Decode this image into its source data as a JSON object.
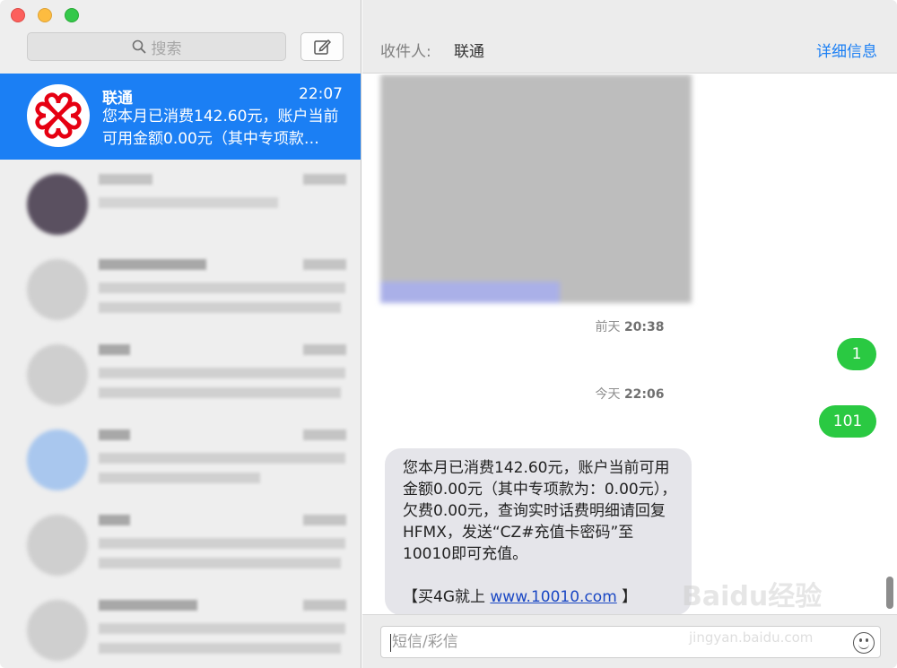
{
  "sidebar": {
    "search_placeholder": "搜索",
    "active_conversation": {
      "name": "联通",
      "time": "22:07",
      "preview": "您本月已消费142.60元，账户当前可用金额0.00元（其中专项款…"
    }
  },
  "header": {
    "recipient_label": "收件人:",
    "recipient_name": "联通",
    "details": "详细信息"
  },
  "chat": {
    "timestamp1_day": "前天",
    "timestamp1_time": "20:38",
    "outgoing1": "1",
    "timestamp2_day": "今天",
    "timestamp2_time": "22:06",
    "outgoing2": "101",
    "incoming_text": "您本月已消费142.60元，账户当前可用金额0.00元（其中专项款为：0.00元），欠费0.00元，查询实时话费明细请回复HFMX，发送“CZ#充值卡密码”至10010即可充值。",
    "incoming_promo_prefix": "【买4G就上 ",
    "incoming_link": "www.10010.com",
    "incoming_promo_suffix": " 】"
  },
  "input": {
    "placeholder": "短信/彩信"
  },
  "watermark": {
    "brand": "Baidu经验",
    "url": "jingyan.baidu.com"
  },
  "colors": {
    "accent": "#1b7ff4",
    "outgoing_bubble": "#2ac942",
    "incoming_bubble": "#e5e5ea"
  }
}
